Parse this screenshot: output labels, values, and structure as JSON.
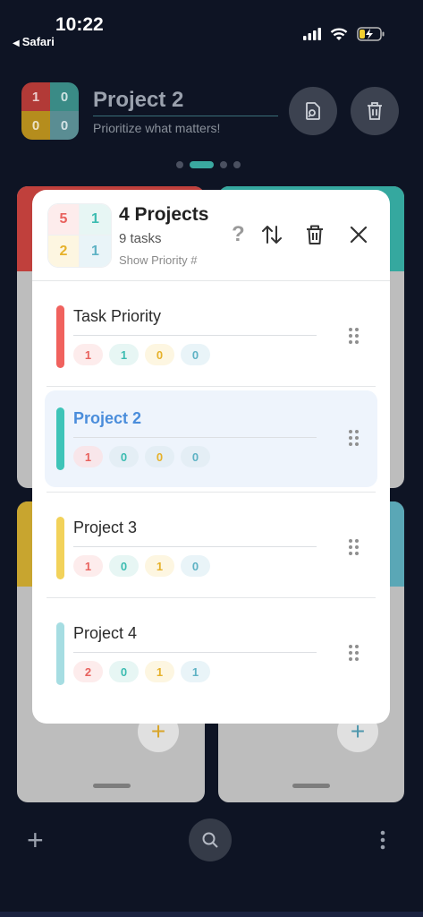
{
  "status": {
    "time": "10:22",
    "back_label": "Safari"
  },
  "header": {
    "matrix": [
      "1",
      "0",
      "0",
      "0"
    ],
    "title": "Project 2",
    "subtitle": "Prioritize what matters!",
    "icons": [
      "rename-icon",
      "trash-icon"
    ]
  },
  "pager": {
    "count": 4,
    "active_index": 1
  },
  "modal": {
    "matrix": [
      "5",
      "1",
      "2",
      "1"
    ],
    "title": "4 Projects",
    "task_count": "9 tasks",
    "show_priority": "Show Priority #",
    "help": "?",
    "icons": [
      "sort-icon",
      "trash-icon",
      "close-icon"
    ],
    "rows": [
      {
        "name": "Task Priority",
        "color": "#f0625e",
        "counts": [
          "1",
          "1",
          "0",
          "0"
        ],
        "selected": false
      },
      {
        "name": "Project 2",
        "color": "#3ec4b8",
        "counts": [
          "1",
          "0",
          "0",
          "0"
        ],
        "selected": true
      },
      {
        "name": "Project 3",
        "color": "#f2d25a",
        "counts": [
          "1",
          "0",
          "1",
          "0"
        ],
        "selected": false
      },
      {
        "name": "Project 4",
        "color": "#a6dde2",
        "counts": [
          "2",
          "0",
          "1",
          "1"
        ],
        "selected": false
      }
    ]
  },
  "background_cards": {
    "plus": "+",
    "colors": {
      "red": "#c0403c",
      "teal": "#35a89f",
      "yellow": "#c8a52f",
      "blue": "#5aa7b6"
    }
  },
  "bottom_bar": {
    "plus": "+"
  }
}
